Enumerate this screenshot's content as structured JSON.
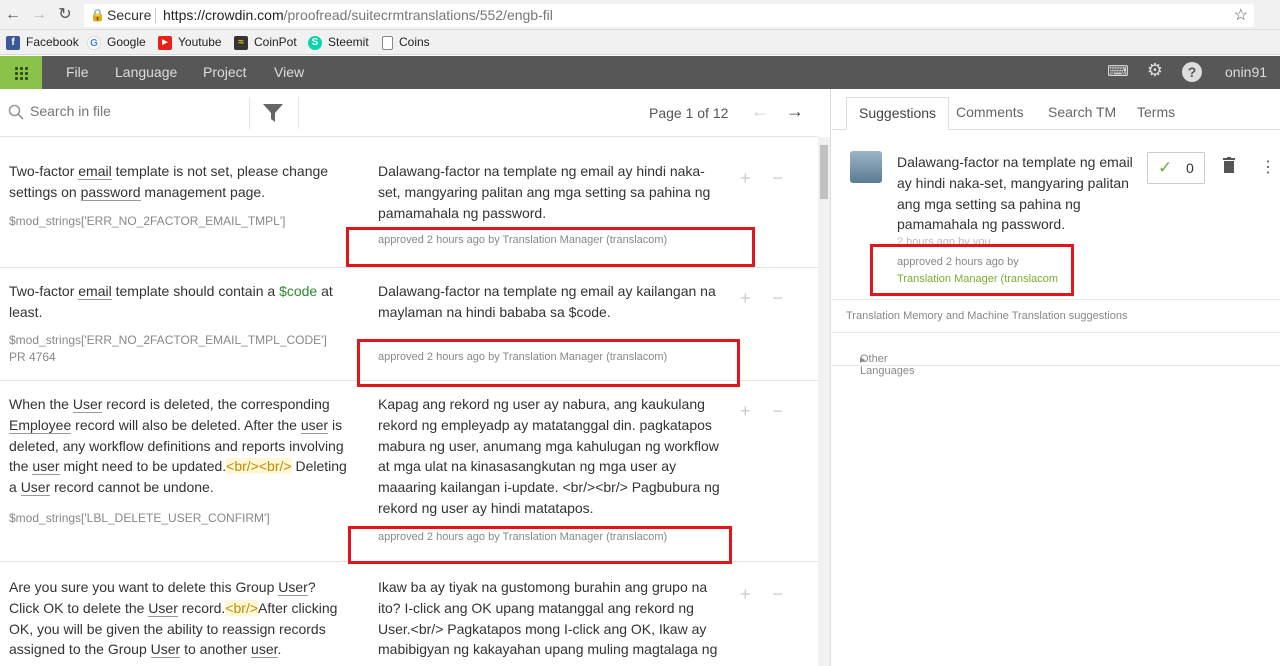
{
  "browser": {
    "secure_label": "Secure",
    "url_host": "https://crowdin.com",
    "url_path": "/proofread/suitecrmtranslations/552/engb-fil"
  },
  "bookmarks": [
    {
      "label": "Facebook",
      "icon": "facebook-icon"
    },
    {
      "label": "Google",
      "icon": "google-icon"
    },
    {
      "label": "Youtube",
      "icon": "youtube-icon"
    },
    {
      "label": "CoinPot",
      "icon": "coinpot-icon"
    },
    {
      "label": "Steemit",
      "icon": "steemit-icon"
    },
    {
      "label": "Coins",
      "icon": "page-icon"
    }
  ],
  "appbar": {
    "menu": [
      "File",
      "Language",
      "Project",
      "View"
    ],
    "username": "onin91"
  },
  "toolbar": {
    "search_placeholder": "Search in file",
    "page_info": "Page 1 of 12"
  },
  "rows": [
    {
      "source_parts": [
        "Two-factor ",
        "email",
        " template is not set, please change settings on ",
        "password",
        " management page."
      ],
      "key": "$mod_strings['ERR_NO_2FACTOR_EMAIL_TMPL']",
      "translation": "Dalawang-factor na template ng email ay hindi naka-set, mangyaring palitan ang mga setting sa pahina ng pamamahala ng password.",
      "approved": "approved 2 hours ago by Translation Manager (translacom)"
    },
    {
      "source_parts": [
        "Two-factor ",
        "email",
        " template should contain a ",
        "$code",
        " at least."
      ],
      "key": "$mod_strings['ERR_NO_2FACTOR_EMAIL_TMPL_CODE']",
      "key2": "PR 4764",
      "translation": "Dalawang-factor na template ng email ay kailangan na maylaman na hindi bababa sa $code.",
      "approved": "approved 2 hours ago by Translation Manager (translacom)"
    },
    {
      "source_parts": [
        "When the ",
        "User",
        " record is deleted, the corresponding ",
        "Employee",
        " record will also be deleted. After the ",
        "user",
        " is deleted, any workflow definitions and reports involving the ",
        "user",
        " might need to be updated.",
        "<br/><br/>",
        " Deleting a ",
        "User",
        " record cannot be undone."
      ],
      "key": "$mod_strings['LBL_DELETE_USER_CONFIRM']",
      "translation": "Kapag ang rekord ng user ay nabura, ang kaukulang rekord ng empleyadp ay matatanggal din. pagkatapos mabura ng user, anumang mga kahulugan ng workflow at mga ulat na kinasasangkutan ng mga user ay maaaring kailangan i-update. <br/><br/> Pagbubura ng rekord ng user ay hindi matatapos.",
      "approved": "approved 2 hours ago by Translation Manager (translacom)"
    },
    {
      "source_parts": [
        "Are you sure you want to delete this Group ",
        "User",
        "? Click OK to delete the ",
        "User",
        " record.",
        "<br/>",
        "After clicking OK, you will be given the ability to reassign records assigned to the Group ",
        "User",
        " to another ",
        "user",
        "."
      ],
      "translation": "Ikaw ba ay tiyak na gustomong burahin ang grupo na ito? I-click ang OK upang matanggal ang rekord ng User.<br/> Pagkatapos mong I-click ang OK, Ikaw ay mabibigyan ng kakayahan upang muling magtalaga ng"
    }
  ],
  "right": {
    "tabs": [
      "Suggestions",
      "Comments",
      "Search TM",
      "Terms"
    ],
    "suggestion_text": "Dalawang-factor na template ng email ay hindi naka-set, mangyaring palitan ang mga setting sa pahina ng pamamahala ng password.",
    "ghost": "2 hours ago by you",
    "approved_line": "approved 2 hours ago by",
    "approved_by": "Translation Manager (translacom",
    "votes": "0",
    "tm_label": "Translation Memory and Machine Translation suggestions",
    "other_languages": "Other Languages"
  }
}
